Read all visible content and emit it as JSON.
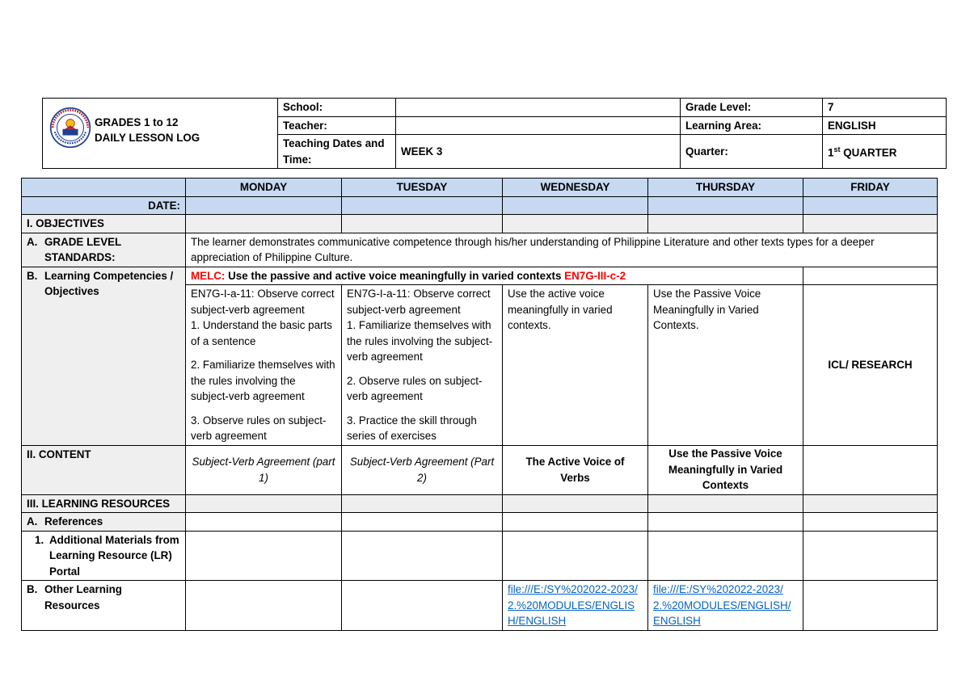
{
  "header": {
    "seal_text": "KAGAWARAN NG EDUKASYON",
    "title_line1": "GRADES 1 to 12",
    "title_line2": "DAILY LESSON LOG",
    "school_label": "School:",
    "school_value": "",
    "teacher_label": "Teacher:",
    "teacher_value": "",
    "dates_label": "Teaching Dates and Time:",
    "dates_value": "WEEK 3",
    "grade_level_label": "Grade Level:",
    "grade_level_value": "7",
    "learning_area_label": "Learning Area:",
    "learning_area_value": "ENGLISH",
    "quarter_label": "Quarter:",
    "quarter_num": "1",
    "quarter_sup": "st",
    "quarter_rest": " QUARTER"
  },
  "days": [
    "MONDAY",
    "TUESDAY",
    "WEDNESDAY",
    "THURSDAY",
    "FRIDAY"
  ],
  "date_label": "DATE:",
  "objectives": {
    "heading": "I. OBJECTIVES",
    "gls_letter": "A.",
    "gls_label": "GRADE LEVEL STANDARDS:",
    "gls_text": "The learner demonstrates communicative competence through his/her understanding of Philippine Literature and other texts types for a deeper appreciation of Philippine Culture.",
    "lc_letter": "B.",
    "lc_label": "Learning Competencies / Objectives",
    "melc_label": "MELC:",
    "melc_text": " Use the passive and active voice meaningfully in varied contexts ",
    "melc_code": "EN7G-III-c-2",
    "monday": {
      "intro": "EN7G-I-a-11: Observe correct subject-verb agreement",
      "item1": "1. Understand the basic parts of a sentence",
      "item2": "2. Familiarize themselves with the rules involving the subject-verb agreement",
      "item3": "3. Observe rules on subject-verb agreement"
    },
    "tuesday": {
      "intro": "EN7G-I-a-11: Observe correct subject-verb agreement",
      "item1": "1. Familiarize themselves with the rules involving the subject-verb agreement",
      "item2": "2. Observe rules on subject-verb agreement",
      "item3": "3. Practice the skill through series of exercises"
    },
    "wednesday": "Use the active voice meaningfully in varied contexts.",
    "thursday": "Use the Passive Voice Meaningfully in Varied Contexts.",
    "friday": "ICL/ RESEARCH"
  },
  "content": {
    "heading": "II. CONTENT",
    "monday": "Subject-Verb Agreement (part 1)",
    "tuesday": "Subject-Verb Agreement (Part 2)",
    "wednesday": "The Active Voice of Verbs",
    "thursday": "Use the Passive Voice Meaningfully in Varied Contexts"
  },
  "resources": {
    "heading": "III. LEARNING RESOURCES",
    "ref_letter": "A.",
    "ref_label": "References",
    "add_num": "1.",
    "add_label": "Additional Materials from Learning Resource (LR) Portal",
    "other_letter": "B.",
    "other_label": "Other Learning Resources",
    "wednesday_link": "file:///E:/SY%202022-2023/2.%20MODULES/ENGLISH/ENGLISH",
    "thursday_link": "file:///E:/SY%202022-2023/2.%20MODULES/ENGLISH/ENGLISH"
  }
}
